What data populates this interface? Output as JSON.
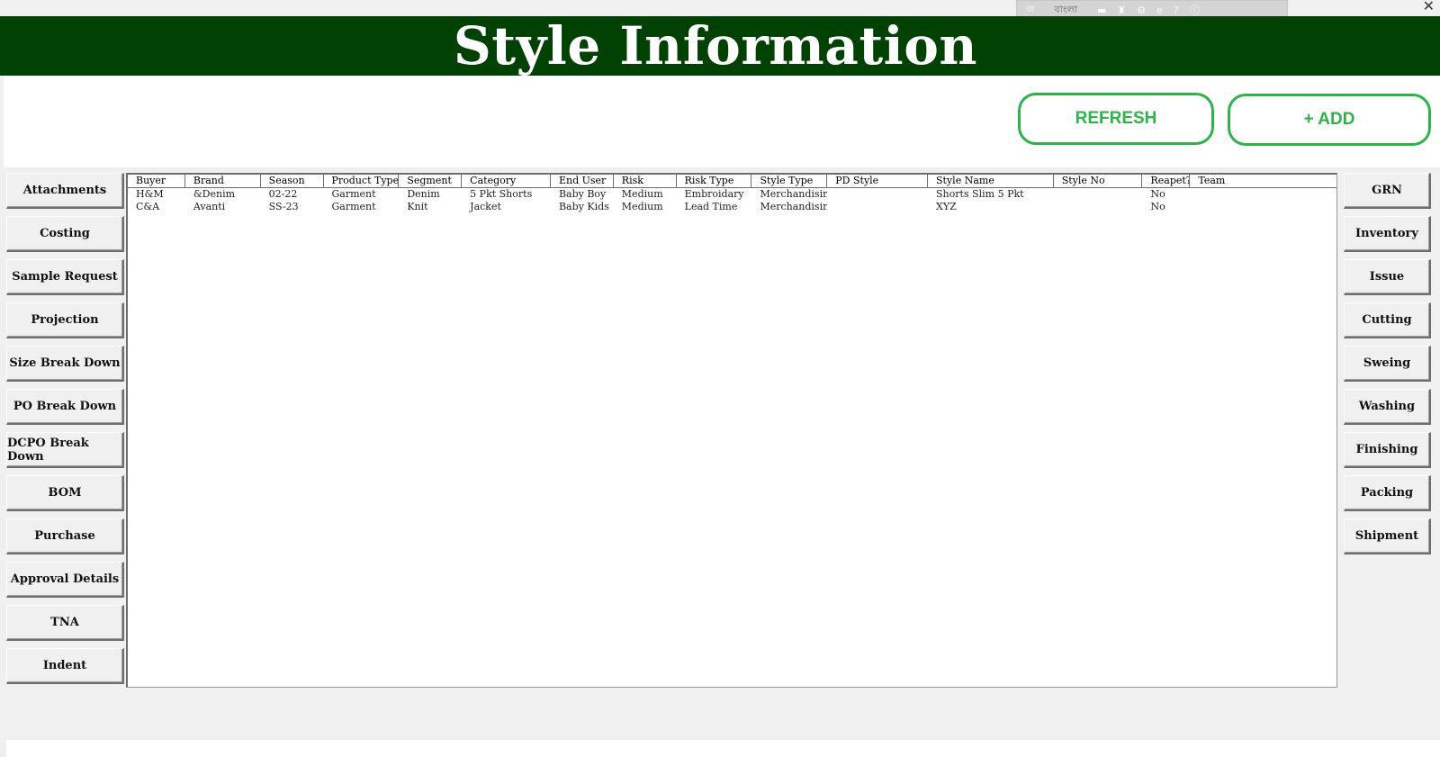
{
  "title": "Style Information",
  "langbar": {
    "label": "বাংলা"
  },
  "actions": {
    "refresh": "REFRESH",
    "add": "+ ADD"
  },
  "left_buttons": [
    "Attachments",
    "Costing",
    "Sample Request",
    "Projection",
    "Size Break Down",
    "PO Break Down",
    "DCPO Break Down",
    "BOM",
    "Purchase",
    "Approval Details",
    "TNA",
    "Indent"
  ],
  "right_buttons": [
    "GRN",
    "Inventory",
    "Issue",
    "Cutting",
    "Sweing",
    "Washing",
    "Finishing",
    "Packing",
    "Shipment"
  ],
  "table": {
    "columns": [
      "Buyer",
      "Brand",
      "Season",
      "Product Type",
      "Segment",
      "Category",
      "End User",
      "Risk",
      "Risk Type",
      "Style Type",
      "PD Style",
      "Style Name",
      "Style No",
      "Reapet?",
      "Team"
    ],
    "rows": [
      [
        "H&M",
        "&Denim",
        "02-22",
        "Garment",
        "Denim",
        "5 Pkt Shorts",
        "Baby Boy",
        "Medium",
        "Embroidary",
        "Merchandising",
        "",
        "Shorts Slim 5 Pkt",
        "",
        "No",
        ""
      ],
      [
        "C&A",
        "Avanti",
        "SS-23",
        "Garment",
        "Knit",
        "Jacket",
        "Baby Kids",
        "Medium",
        "Lead Time",
        "Merchandising",
        "",
        "XYZ",
        "",
        "No",
        ""
      ]
    ]
  },
  "colors": {
    "header_bg": "#014204",
    "accent": "#2db34a"
  }
}
